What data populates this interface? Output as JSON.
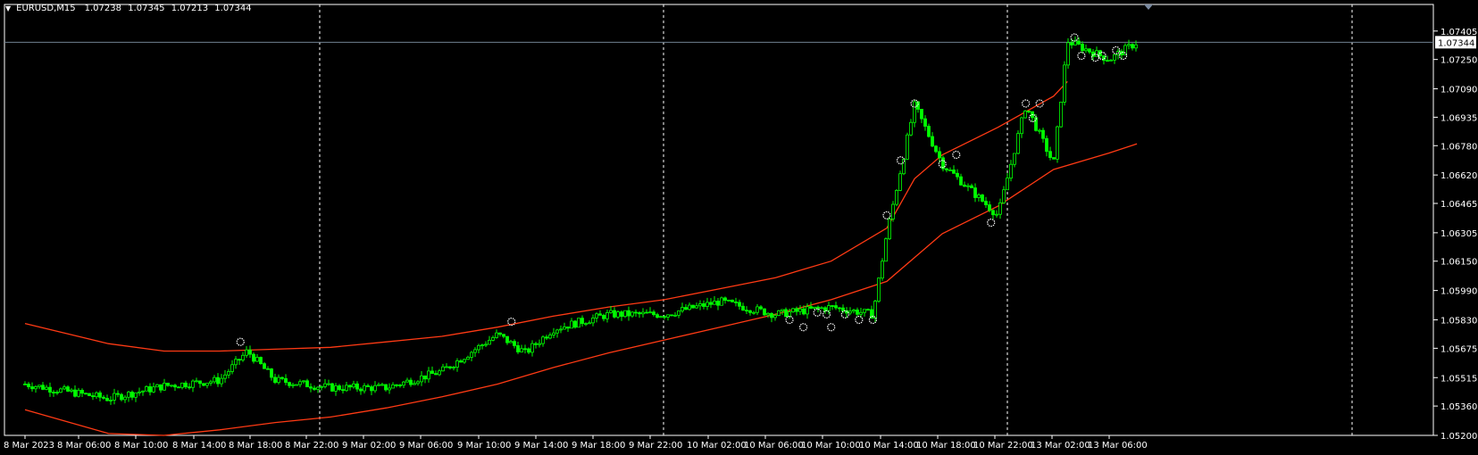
{
  "header": {
    "symbol": "EURUSD,M15",
    "open": "1.07238",
    "high": "1.07345",
    "low": "1.07213",
    "close": "1.07344"
  },
  "colors": {
    "background": "#000000",
    "frame": "#ffffff",
    "candles": "#00ff00",
    "bands": "#ff3a14",
    "grid": "#ffffff",
    "current_price_line": "#708090",
    "markers": "#ffffff"
  },
  "chart_data": {
    "type": "candlestick",
    "grid": "vertical dashed",
    "current_price": 1.07344,
    "ylim": [
      1.052,
      1.0755
    ],
    "y_ticks": [
      "1.07405",
      "1.07250",
      "1.07090",
      "1.06935",
      "1.06780",
      "1.06620",
      "1.06465",
      "1.06305",
      "1.06150",
      "1.05990",
      "1.05830",
      "1.05675",
      "1.05515",
      "1.05360",
      "1.05200"
    ],
    "x_ticks": [
      "8 Mar 2023",
      "8 Mar 06:00",
      "8 Mar 10:00",
      "8 Mar 14:00",
      "8 Mar 18:00",
      "8 Mar 22:00",
      "9 Mar 02:00",
      "9 Mar 06:00",
      "9 Mar 10:00",
      "9 Mar 14:00",
      "9 Mar 18:00",
      "9 Mar 22:00",
      "10 Mar 02:00",
      "10 Mar 06:00",
      "10 Mar 10:00",
      "10 Mar 14:00",
      "10 Mar 18:00",
      "10 Mar 22:00",
      "13 Mar 02:00",
      "13 Mar 06:00"
    ],
    "x_gridlines_at": [
      "8 Mar 22:00",
      "9 Mar 22:00",
      "10 Mar 22:00"
    ],
    "price_path": [
      {
        "x": "8 Mar 2023",
        "y": 1.0548
      },
      {
        "x": "8 Mar 06:00",
        "y": 1.054
      },
      {
        "x": "8 Mar 10:00",
        "y": 1.0547
      },
      {
        "x": "8 Mar 14:00",
        "y": 1.055
      },
      {
        "x": "8 Mar 16:00",
        "y": 1.0566
      },
      {
        "x": "8 Mar 18:00",
        "y": 1.055
      },
      {
        "x": "8 Mar 22:00",
        "y": 1.0546
      },
      {
        "x": "9 Mar 02:00",
        "y": 1.0546
      },
      {
        "x": "9 Mar 06:00",
        "y": 1.0555
      },
      {
        "x": "9 Mar 10:00",
        "y": 1.0575
      },
      {
        "x": "9 Mar 12:00",
        "y": 1.0565
      },
      {
        "x": "9 Mar 14:00",
        "y": 1.0578
      },
      {
        "x": "9 Mar 18:00",
        "y": 1.0586
      },
      {
        "x": "9 Mar 22:00",
        "y": 1.0586
      },
      {
        "x": "10 Mar 02:00",
        "y": 1.0593
      },
      {
        "x": "10 Mar 06:00",
        "y": 1.0586
      },
      {
        "x": "10 Mar 10:00",
        "y": 1.059
      },
      {
        "x": "10 Mar 13:00",
        "y": 1.0586
      },
      {
        "x": "10 Mar 14:00",
        "y": 1.063
      },
      {
        "x": "10 Mar 16:00",
        "y": 1.07
      },
      {
        "x": "10 Mar 18:00",
        "y": 1.0668
      },
      {
        "x": "10 Mar 22:00",
        "y": 1.064
      },
      {
        "x": "13 Mar 00:00",
        "y": 1.07
      },
      {
        "x": "13 Mar 02:00",
        "y": 1.0668
      },
      {
        "x": "13 Mar 03:00",
        "y": 1.0735
      },
      {
        "x": "13 Mar 06:00",
        "y": 1.0725
      },
      {
        "x": "13 Mar 08:00",
        "y": 1.07344
      }
    ],
    "upper_band": [
      {
        "x": "8 Mar 2023",
        "y": 1.0581
      },
      {
        "x": "8 Mar 06:00",
        "y": 1.057
      },
      {
        "x": "8 Mar 10:00",
        "y": 1.0566
      },
      {
        "x": "8 Mar 14:00",
        "y": 1.0566
      },
      {
        "x": "8 Mar 18:00",
        "y": 1.0567
      },
      {
        "x": "8 Mar 22:00",
        "y": 1.0568
      },
      {
        "x": "9 Mar 02:00",
        "y": 1.0571
      },
      {
        "x": "9 Mar 06:00",
        "y": 1.0574
      },
      {
        "x": "9 Mar 10:00",
        "y": 1.0579
      },
      {
        "x": "9 Mar 14:00",
        "y": 1.0585
      },
      {
        "x": "9 Mar 18:00",
        "y": 1.059
      },
      {
        "x": "9 Mar 22:00",
        "y": 1.0594
      },
      {
        "x": "10 Mar 02:00",
        "y": 1.06
      },
      {
        "x": "10 Mar 06:00",
        "y": 1.0606
      },
      {
        "x": "10 Mar 10:00",
        "y": 1.0615
      },
      {
        "x": "10 Mar 14:00",
        "y": 1.0633
      },
      {
        "x": "10 Mar 16:00",
        "y": 1.066
      },
      {
        "x": "10 Mar 18:00",
        "y": 1.0673
      },
      {
        "x": "10 Mar 22:00",
        "y": 1.0688
      },
      {
        "x": "13 Mar 02:00",
        "y": 1.0705
      },
      {
        "x": "13 Mar 03:00",
        "y": 1.0713
      }
    ],
    "lower_band": [
      {
        "x": "8 Mar 2023",
        "y": 1.0534
      },
      {
        "x": "8 Mar 06:00",
        "y": 1.0521
      },
      {
        "x": "8 Mar 10:00",
        "y": 1.052
      },
      {
        "x": "8 Mar 14:00",
        "y": 1.0523
      },
      {
        "x": "8 Mar 18:00",
        "y": 1.0527
      },
      {
        "x": "8 Mar 22:00",
        "y": 1.053
      },
      {
        "x": "9 Mar 02:00",
        "y": 1.0535
      },
      {
        "x": "9 Mar 06:00",
        "y": 1.0541
      },
      {
        "x": "9 Mar 10:00",
        "y": 1.0548
      },
      {
        "x": "9 Mar 14:00",
        "y": 1.0557
      },
      {
        "x": "9 Mar 18:00",
        "y": 1.0565
      },
      {
        "x": "9 Mar 22:00",
        "y": 1.0572
      },
      {
        "x": "10 Mar 02:00",
        "y": 1.0579
      },
      {
        "x": "10 Mar 06:00",
        "y": 1.0586
      },
      {
        "x": "10 Mar 10:00",
        "y": 1.0594
      },
      {
        "x": "10 Mar 14:00",
        "y": 1.0604
      },
      {
        "x": "10 Mar 18:00",
        "y": 1.063
      },
      {
        "x": "10 Mar 22:00",
        "y": 1.0645
      },
      {
        "x": "13 Mar 02:00",
        "y": 1.0665
      },
      {
        "x": "13 Mar 06:00",
        "y": 1.0674
      },
      {
        "x": "13 Mar 08:00",
        "y": 1.0679
      }
    ],
    "markers": [
      {
        "x": "8 Mar 15:30",
        "y": 1.0571
      },
      {
        "x": "9 Mar 11:00",
        "y": 1.0582
      },
      {
        "x": "10 Mar 07:00",
        "y": 1.0583
      },
      {
        "x": "10 Mar 08:00",
        "y": 1.0579
      },
      {
        "x": "10 Mar 09:00",
        "y": 1.0587
      },
      {
        "x": "10 Mar 09:40",
        "y": 1.0586
      },
      {
        "x": "10 Mar 10:00",
        "y": 1.0579
      },
      {
        "x": "10 Mar 11:00",
        "y": 1.0586
      },
      {
        "x": "10 Mar 12:00",
        "y": 1.0583
      },
      {
        "x": "10 Mar 13:00",
        "y": 1.0583
      },
      {
        "x": "10 Mar 14:00",
        "y": 1.064
      },
      {
        "x": "10 Mar 15:00",
        "y": 1.067
      },
      {
        "x": "10 Mar 16:00",
        "y": 1.0701
      },
      {
        "x": "10 Mar 18:00",
        "y": 1.0668
      },
      {
        "x": "10 Mar 19:00",
        "y": 1.0673
      },
      {
        "x": "10 Mar 21:30",
        "y": 1.0636
      },
      {
        "x": "13 Mar 00:00",
        "y": 1.0701
      },
      {
        "x": "13 Mar 00:30",
        "y": 1.0693
      },
      {
        "x": "13 Mar 01:00",
        "y": 1.0701
      },
      {
        "x": "13 Mar 03:30",
        "y": 1.0737
      },
      {
        "x": "13 Mar 04:00",
        "y": 1.0727
      },
      {
        "x": "13 Mar 05:00",
        "y": 1.0726
      },
      {
        "x": "13 Mar 05:30",
        "y": 1.0727
      },
      {
        "x": "13 Mar 06:30",
        "y": 1.073
      },
      {
        "x": "13 Mar 07:00",
        "y": 1.0727
      }
    ]
  }
}
